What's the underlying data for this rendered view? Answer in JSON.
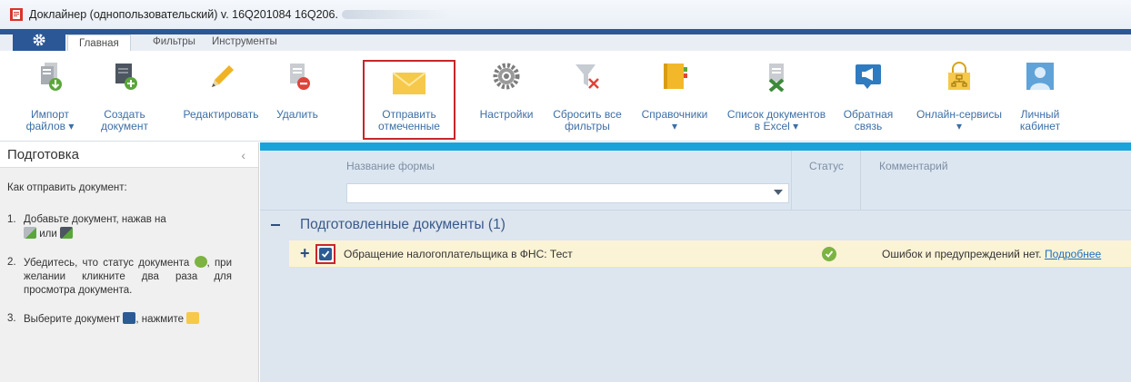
{
  "window": {
    "title": "Доклайнер (однопользовательский) v. 16Q201084 16Q206."
  },
  "tabs": [
    {
      "label": "Главная",
      "active": true
    },
    {
      "label": "Фильтры",
      "active": false
    },
    {
      "label": "Инструменты",
      "active": false
    }
  ],
  "ribbon": {
    "import": {
      "line1": "Импорт",
      "line2": "файлов ▾"
    },
    "create": {
      "line1": "Создать",
      "line2": "документ"
    },
    "edit": {
      "line1": "Редактировать",
      "line2": ""
    },
    "delete": {
      "line1": "Удалить",
      "line2": ""
    },
    "send": {
      "line1": "Отправить",
      "line2": "отмеченные",
      "highlighted": true
    },
    "settings": {
      "line1": "Настройки",
      "line2": ""
    },
    "reset": {
      "line1": "Сбросить все",
      "line2": "фильтры"
    },
    "refs": {
      "line1": "Справочники",
      "line2": "▾"
    },
    "excel": {
      "line1": "Список документов",
      "line2": "в Excel ▾"
    },
    "feedback": {
      "line1": "Обратная",
      "line2": "связь"
    },
    "online": {
      "line1": "Онлайн-сервисы",
      "line2": "▾"
    },
    "cabinet": {
      "line1": "Личный",
      "line2": "кабинет"
    }
  },
  "left_panel": {
    "title": "Подготовка",
    "question": "Как отправить документ:",
    "step1_num": "1.",
    "step1_a": "Добавьте документ, нажав на",
    "step1_b": "или",
    "step2_num": "2.",
    "step2_a": "Убедитесь, что статус документа",
    "step2_b": ", при желании кликните два раза для просмотра документа.",
    "step3_num": "3.",
    "step3_a": "Выберите документ",
    "step3_b": ", нажмите"
  },
  "grid": {
    "col_name": "Название формы",
    "col_status": "Статус",
    "col_comment": "Комментарий",
    "group_title": "Подготовленные документы (1)",
    "rows": [
      {
        "name": "Обращение налогоплательщика в ФНС: Тест",
        "checked": true,
        "status": "ok",
        "comment": "Ошибок и предупреждений нет.",
        "link": "Подробнее"
      }
    ]
  },
  "colors": {
    "accent": "#1aa3d9",
    "ribbon_tab": "#2b5797",
    "highlight": "#c8262b",
    "row_bg": "#fbf3d5",
    "ok": "#7cb342"
  }
}
